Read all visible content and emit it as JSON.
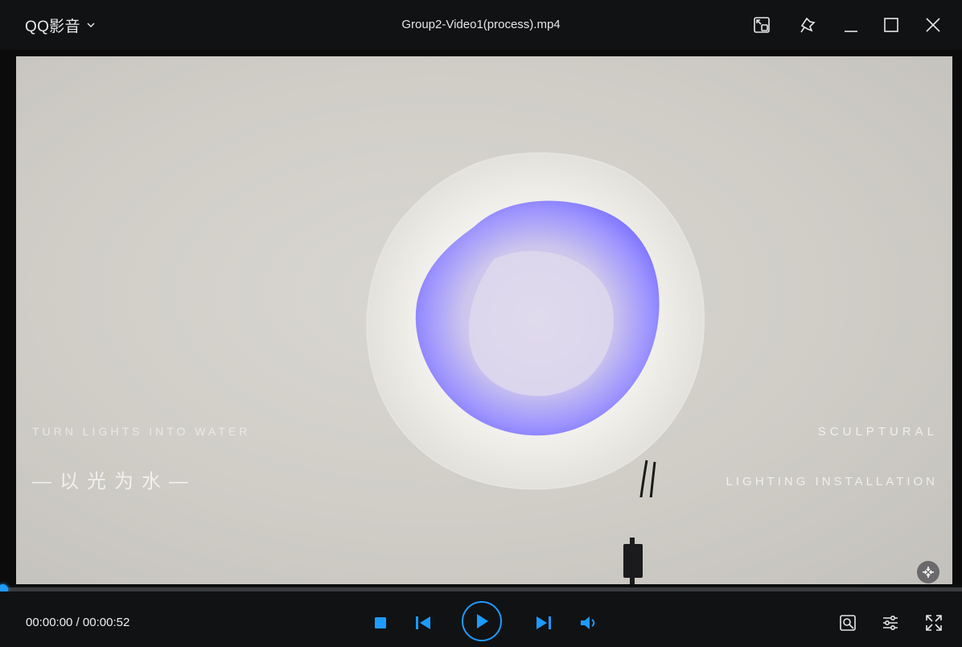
{
  "app": {
    "brand": "QQ影音",
    "file_title": "Group2-Video1(process).mp4"
  },
  "video": {
    "overlay_left_line1": "TURN LIGHTS INTO WATER",
    "overlay_left_line2": "—以光为水—",
    "overlay_right_line1": "SCULPTURAL",
    "overlay_right_line2": "LIGHTING INSTALLATION"
  },
  "playback": {
    "current_time": "00:00:00",
    "separator": " / ",
    "duration": "00:00:52",
    "progress": 0.0
  },
  "icons": {
    "brand_caret": "chevron-down-icon",
    "mini_mode": "mini-mode-icon",
    "pin": "pin-icon",
    "minimize": "minimize-icon",
    "maximize": "maximize-icon",
    "close": "close-icon",
    "stop": "stop-icon",
    "previous": "skip-previous-icon",
    "play": "play-icon",
    "next": "skip-next-icon",
    "volume": "volume-icon",
    "toolbox": "toolbox-icon",
    "settings": "settings-sliders-icon",
    "fullscreen": "fullscreen-icon",
    "snapshot": "collapse-icon"
  },
  "colors": {
    "accent": "#1e9bff",
    "background": "#111214",
    "glow": "#8f87ff"
  }
}
